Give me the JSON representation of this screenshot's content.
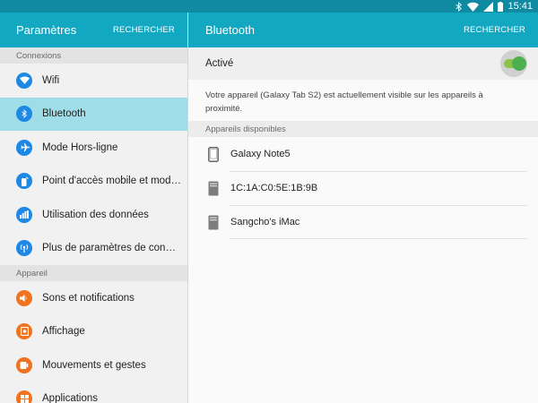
{
  "status_bar": {
    "time": "15:41",
    "icons": [
      "bluetooth-icon",
      "wifi-icon",
      "signal-icon",
      "battery-icon"
    ]
  },
  "left_panel": {
    "title": "Paramètres",
    "action": "RECHERCHER",
    "sections": [
      {
        "header": "Connexions",
        "items": [
          {
            "label": "Wifi",
            "icon": "wifi-icon",
            "color": "#1e88e5"
          },
          {
            "label": "Bluetooth",
            "icon": "bluetooth-icon",
            "color": "#1e88e5",
            "selected": true
          },
          {
            "label": "Mode Hors-ligne",
            "icon": "airplane-icon",
            "color": "#1e88e5"
          },
          {
            "label": "Point d'accès mobile et modem",
            "icon": "hotspot-icon",
            "color": "#1e88e5"
          },
          {
            "label": "Utilisation des données",
            "icon": "data-usage-icon",
            "color": "#1e88e5"
          },
          {
            "label": "Plus de paramètres de connex..",
            "icon": "more-connection-icon",
            "color": "#1e88e5"
          }
        ]
      },
      {
        "header": "Appareil",
        "items": [
          {
            "label": "Sons et notifications",
            "icon": "speaker-icon",
            "color": "#f0731f"
          },
          {
            "label": "Affichage",
            "icon": "display-icon",
            "color": "#f0731f"
          },
          {
            "label": "Mouvements et gestes",
            "icon": "gesture-icon",
            "color": "#f0731f"
          },
          {
            "label": "Applications",
            "icon": "apps-icon",
            "color": "#f0731f"
          }
        ]
      }
    ]
  },
  "right_panel": {
    "title": "Bluetooth",
    "action": "RECHERCHER",
    "toggle_label": "Activé",
    "toggle_on": true,
    "visibility_text": "Votre appareil (Galaxy Tab S2) est actuellement visible sur les appareils à proximité.",
    "devices_header": "Appareils disponibles",
    "devices": [
      {
        "name": "Galaxy Note5",
        "icon": "phone-icon"
      },
      {
        "name": "1C:1A:C0:5E:1B:9B",
        "icon": "computer-icon"
      },
      {
        "name": "Sangcho's iMac",
        "icon": "computer-icon"
      }
    ]
  },
  "colors": {
    "accent": "#12a8c2",
    "status_bar": "#0f8aa0",
    "selected_item": "#9fdde8",
    "toggle_on": "#4caf50"
  }
}
